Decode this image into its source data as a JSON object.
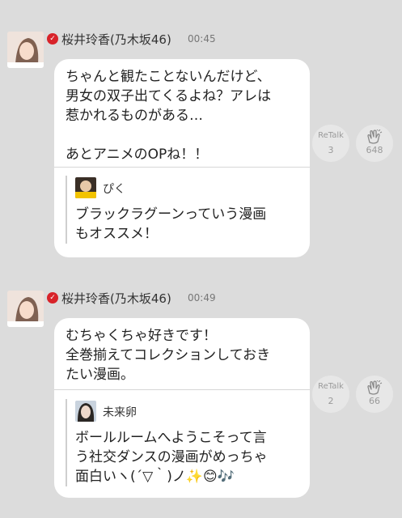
{
  "posts": [
    {
      "author": "桜井玲香(乃木坂46)",
      "time": "00:45",
      "text": "ちゃんと観たことないんだけど、\n男女の双子出てくるよね？アレは\n惹かれるものがある…\n\nあとアニメのOPね！！",
      "quote": {
        "author": "ぴく",
        "text": "ブラックラグーンっていう漫画\nもオススメ！"
      },
      "retalk_label": "ReTalk",
      "retalk_count": "3",
      "clap_count": "648"
    },
    {
      "author": "桜井玲香(乃木坂46)",
      "time": "00:49",
      "text": "むちゃくちゃ好きです！\n全巻揃えてコレクションしておき\nたい漫画。",
      "quote": {
        "author": "未来卵",
        "text": "ボールルームへようこそって言\nう社交ダンスの漫画がめっちゃ\n面白いヽ(´▽｀)ノ✨😊🎶"
      },
      "retalk_label": "ReTalk",
      "retalk_count": "2",
      "clap_count": "66"
    }
  ],
  "colors": {
    "background": "#dcdcdc",
    "bubble": "#ffffff",
    "verified": "#d8232a"
  },
  "icons": {
    "verified": "verified-check-icon",
    "clap": "clap-hands-icon"
  }
}
